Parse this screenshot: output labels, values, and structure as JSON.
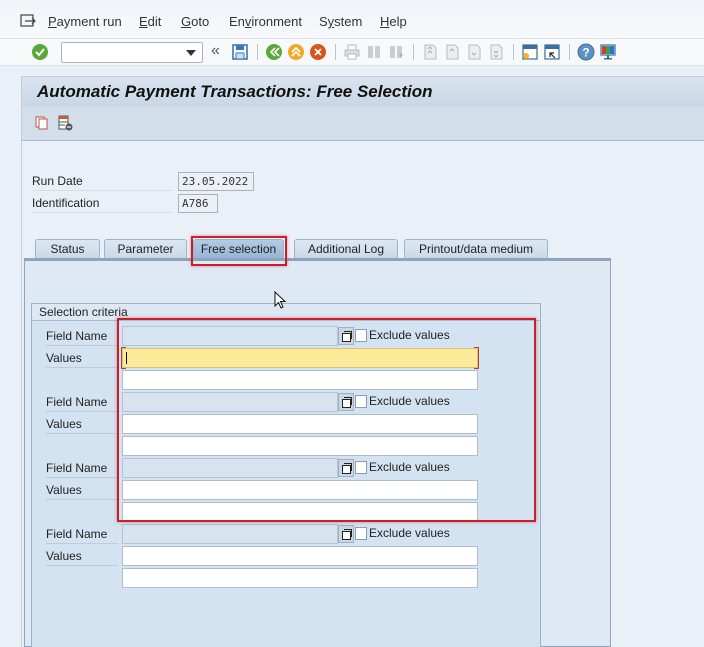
{
  "menubar": {
    "items": [
      {
        "label": "Payment run",
        "mnemonic": "P"
      },
      {
        "label": "Edit",
        "mnemonic": "E"
      },
      {
        "label": "Goto",
        "mnemonic": "G"
      },
      {
        "label": "Environment",
        "mnemonic": "v"
      },
      {
        "label": "System",
        "mnemonic": "y"
      },
      {
        "label": "Help",
        "mnemonic": "H"
      }
    ]
  },
  "toolbar": {
    "command_field": {
      "value": "",
      "placeholder": ""
    },
    "icons": [
      "enter-icon",
      "save-icon",
      "back-icon",
      "exit-icon",
      "cancel-icon",
      "print-icon",
      "find-icon",
      "find-next-icon",
      "first-page-icon",
      "previous-page-icon",
      "next-page-icon",
      "last-page-icon",
      "create-session-icon",
      "shortcut-icon",
      "help-icon",
      "customize-layout-icon"
    ]
  },
  "title": "Automatic Payment Transactions: Free Selection",
  "app_toolbar": {
    "icons": [
      "copy-icon",
      "delete-row-icon"
    ]
  },
  "header": {
    "run_date": {
      "label": "Run Date",
      "value": "23.05.2022"
    },
    "identification": {
      "label": "Identification",
      "value": "A786"
    }
  },
  "tabs": [
    {
      "label": "Status",
      "active": false
    },
    {
      "label": "Parameter",
      "active": false
    },
    {
      "label": "Free selection",
      "active": true
    },
    {
      "label": "Additional Log",
      "active": false
    },
    {
      "label": "Printout/data medium",
      "active": false
    }
  ],
  "selection_criteria": {
    "title": "Selection criteria",
    "field_name_label": "Field Name",
    "values_label": "Values",
    "exclude_label": "Exclude values",
    "rows": [
      {
        "field_name": "",
        "exclude": false,
        "value1": "",
        "value2": ""
      },
      {
        "field_name": "",
        "exclude": false,
        "value1": "",
        "value2": ""
      },
      {
        "field_name": "",
        "exclude": false,
        "value1": "",
        "value2": ""
      },
      {
        "field_name": "",
        "exclude": false,
        "value1": "",
        "value2": ""
      }
    ]
  },
  "colors": {
    "highlight": "#c8202a",
    "focused_input": "#fde99a",
    "active_tab": "#95b4d6"
  }
}
